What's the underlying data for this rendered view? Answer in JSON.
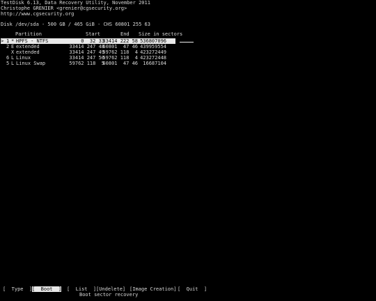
{
  "header": {
    "app_line": "TestDisk 6.13, Data Recovery Utility, November 2011",
    "author_line": "Christophe GRENIER <grenier@cgsecurity.org>",
    "url_line": "http://www.cgsecurity.org"
  },
  "disk": {
    "info": "Disk /dev/sda - 500 GB / 465 GiB - CHS 60801 255 63"
  },
  "table": {
    "columns": {
      "partition": "Partition",
      "start": "Start",
      "end": "End",
      "size": "Size in sectors"
    },
    "rows": [
      {
        "cursor": ">",
        "num": "1",
        "flag": "*",
        "type": "HPFS - NTFS",
        "start": "0  32 33",
        "end": "33414 222 58",
        "size": "536807096",
        "selected": true
      },
      {
        "cursor": "",
        "num": "2",
        "flag": "E",
        "type": "extended",
        "start": "33414 247 48",
        "end": "60801  47 46",
        "size": "439959554",
        "selected": false
      },
      {
        "cursor": "",
        "num": "",
        "flag": "X",
        "type": "extended",
        "start": "33414 247 49",
        "end": "59762 118  4",
        "size": "423272449",
        "selected": false
      },
      {
        "cursor": "",
        "num": "6",
        "flag": "L",
        "type": "Linux",
        "start": "33414 247 50",
        "end": "59762 118  4",
        "size": "423272448",
        "selected": false
      },
      {
        "cursor": "",
        "num": "5",
        "flag": "L",
        "type": "Linux Swap",
        "start": "59762 118  5",
        "end": "60801  47 46",
        "size": "16687104",
        "selected": false
      }
    ]
  },
  "menu": {
    "type": "[  Type  ]",
    "boot": "[  Boot  ]",
    "list": "[  List  ]",
    "undelete": "[Undelete]",
    "image_creation": "[Image Creation]",
    "quit": "[  Quit  ]",
    "active_item": "boot"
  },
  "status": {
    "text": "Boot sector recovery"
  },
  "colors": {
    "background": "#000000",
    "foreground": "#d9d9d9",
    "highlight": "#e8e8e8"
  }
}
